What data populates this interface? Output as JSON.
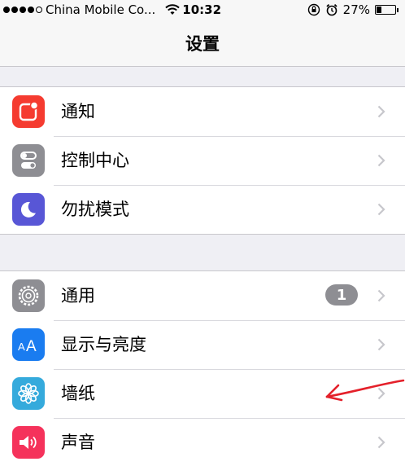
{
  "status_bar": {
    "carrier": "China Mobile Co...",
    "time": "10:32",
    "battery": "27%",
    "battery_fraction": 0.27
  },
  "nav": {
    "title": "设置"
  },
  "groups": [
    {
      "items": [
        {
          "label": "通知",
          "icon": "notifications-icon",
          "icon_color": "#f53b30"
        },
        {
          "label": "控制中心",
          "icon": "control-center-icon",
          "icon_color": "#8e8e93"
        },
        {
          "label": "勿扰模式",
          "icon": "do-not-disturb-icon",
          "icon_color": "#5856d6"
        }
      ]
    },
    {
      "items": [
        {
          "label": "通用",
          "icon": "general-gear-icon",
          "icon_color": "#8e8e93",
          "badge": "1"
        },
        {
          "label": "显示与亮度",
          "icon": "display-brightness-icon",
          "icon_color": "#1a7cf0"
        },
        {
          "label": "墙纸",
          "icon": "wallpaper-icon",
          "icon_color": "#35aadc"
        },
        {
          "label": "声音",
          "icon": "sounds-icon",
          "icon_color": "#f5325b"
        }
      ]
    }
  ],
  "annotation": {
    "type": "red-hand-drawn-arrow",
    "color": "#e4202a"
  }
}
